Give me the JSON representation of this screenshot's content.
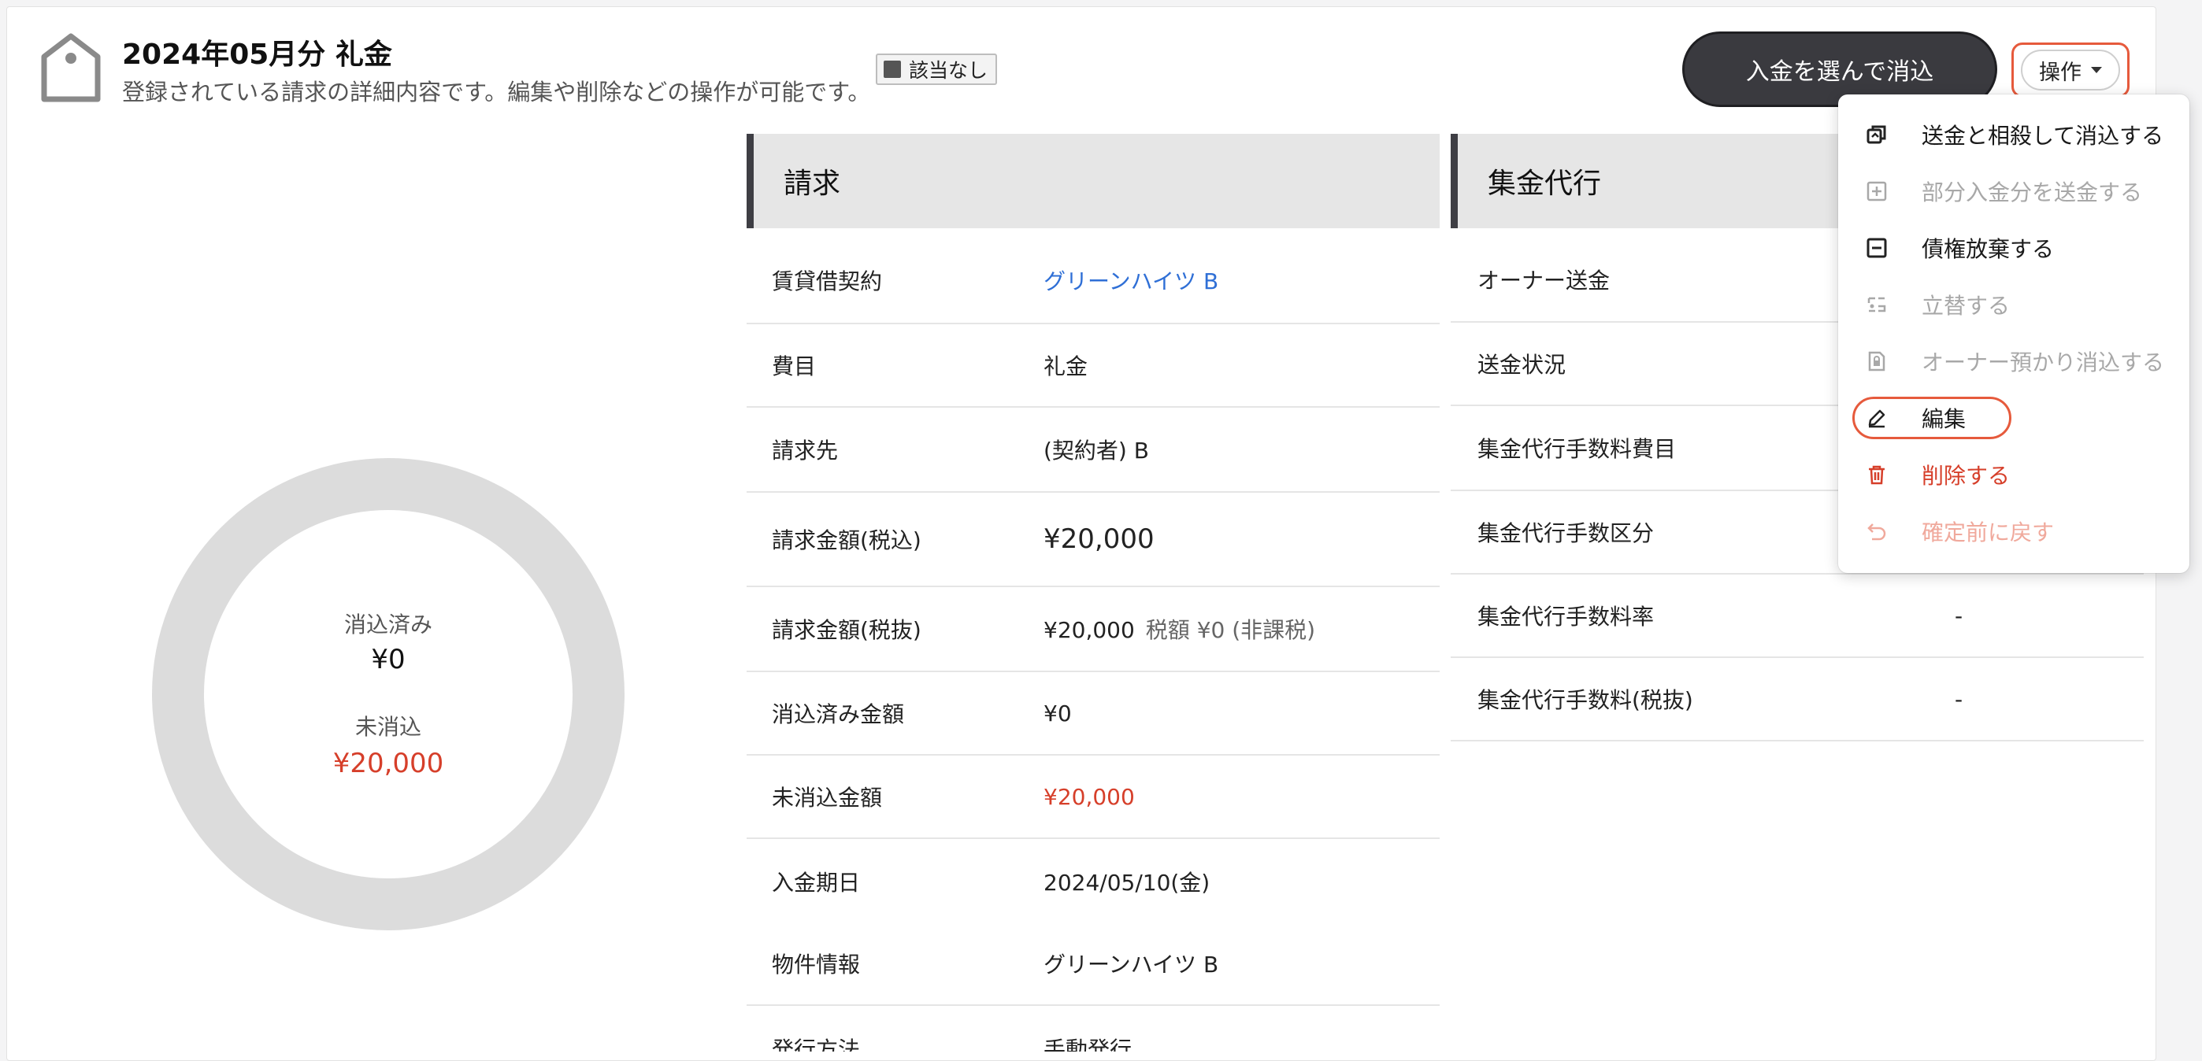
{
  "header": {
    "title": "2024年05月分 礼金",
    "subtitle": "登録されている請求の詳細内容です。編集や削除などの操作が可能です。",
    "status_badge": "該当なし",
    "primary_button": "入金を選んで消込",
    "ops_button": "操作"
  },
  "donut": {
    "applied_label": "消込済み",
    "applied_value": "¥0",
    "unapplied_label": "未消込",
    "unapplied_value": "¥20,000",
    "applied_fraction": 0
  },
  "billing": {
    "heading": "請求",
    "rows": [
      {
        "label": "賃貸借契約",
        "value": "グリーンハイツ B"
      },
      {
        "label": "費目",
        "value": "礼金"
      },
      {
        "label": "請求先",
        "value": "(契約者) B"
      },
      {
        "label": "請求金額(税込)",
        "value": "¥20,000"
      },
      {
        "label": "請求金額(税抜)",
        "value": "¥20,000",
        "extra": "税額 ¥0 (非課税)"
      },
      {
        "label": "消込済み金額",
        "value": "¥0"
      },
      {
        "label": "未消込金額",
        "value": "¥20,000"
      },
      {
        "label": "入金期日",
        "value": "2024/05/10(金)"
      },
      {
        "label": "物件情報",
        "value": "グリーンハイツ B"
      },
      {
        "label": "発行方法",
        "value": "手動発行"
      }
    ]
  },
  "collection": {
    "heading": "集金代行",
    "rows": [
      {
        "label": "オーナー送金",
        "value": ""
      },
      {
        "label": "送金状況",
        "value": ""
      },
      {
        "label": "集金代行手数料費目",
        "value": ""
      },
      {
        "label": "集金代行手数区分",
        "value": ""
      },
      {
        "label": "集金代行手数料率",
        "value": "-"
      },
      {
        "label": "集金代行手数料(税抜)",
        "value": "-"
      }
    ]
  },
  "menu": {
    "items": [
      {
        "label": "送金と相殺して消込する",
        "icon": "offset-icon",
        "state": "enabled"
      },
      {
        "label": "部分入金分を送金する",
        "icon": "plus-square-icon",
        "state": "disabled"
      },
      {
        "label": "債権放棄する",
        "icon": "minus-square-icon",
        "state": "enabled"
      },
      {
        "label": "立替する",
        "icon": "advance-icon",
        "state": "disabled"
      },
      {
        "label": "オーナー預かり消込する",
        "icon": "lock-document-icon",
        "state": "disabled"
      },
      {
        "label": "編集",
        "icon": "pencil-icon",
        "state": "enabled"
      },
      {
        "label": "削除する",
        "icon": "trash-icon",
        "state": "danger"
      },
      {
        "label": "確定前に戻す",
        "icon": "undo-icon",
        "state": "danger-disabled"
      }
    ]
  },
  "colors": {
    "accent_red": "#d63f2a",
    "link_blue": "#2f6fd6",
    "dark_button": "#3a3a3f",
    "highlight_outline": "#e65a3c"
  }
}
